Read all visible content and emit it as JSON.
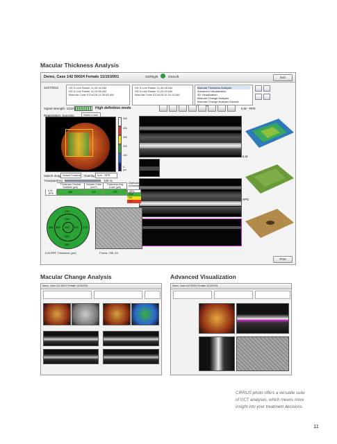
{
  "headings": {
    "macular_thickness": "Macular Thickness Analysis",
    "macular_change": "Macular Change Analysis",
    "advanced_visualization": "Advanced Visualization"
  },
  "main_window": {
    "title": "Demo, Case 142   50024   Female   11/15/2001",
    "eye_od": "OD/Right",
    "eye_os": "OS/Left",
    "exit_label": "Exit",
    "print_label": "Print",
    "exam_date": "10/27/2012",
    "scans_left": [
      "HD 5 Line Raster  11:35:42 AM",
      "HD 5 Line Raster  11:25:50 AM",
      "Macular Cube 512x128  11:30:45 AM"
    ],
    "scans_right": [
      "HD 5 Line Raster  11:36:28 AM",
      "HD 5 Line Raster  11:28:20 AM",
      "Macular Cube 512x128  11:31:15 AM"
    ],
    "analysis_items": [
      "Macular Thickness Analysis",
      "Advanced Visualization",
      "3D Visualization",
      "Macular Change Analysis",
      "Macular Change Analysis   Manual Selection"
    ],
    "signal_strength_label": "Signal strength: 10/10",
    "hd_mode_label": "High definition mode",
    "registration_label": "Registration: Success",
    "registration_value": "Switch Lists",
    "ilm_rpe": "ILM - RPE",
    "ilm": "ILM",
    "rpe": "RPE",
    "scale_values": [
      "500",
      "400",
      "300",
      "200",
      "100",
      "0 µm"
    ],
    "overlay_label": "Overlay",
    "overlay_value": "ILM - RPE",
    "switch_image_label": "Switch Image",
    "switch_image_value": "Select Fundus",
    "transparency_label": "Transparency",
    "transparency_value": "100 %",
    "table_headers": [
      "Thickness Central Subfield (µm)",
      "Volume Cube (mm³)",
      "Thickness Avg Cube (µm)"
    ],
    "table_row_label": "ILM - RPE",
    "table_row_values": [
      "262",
      "9.9",
      "275"
    ],
    "distribution_label": "Distribution of Normals",
    "distribution_values": [
      "99%",
      "95%",
      "5%",
      "1%"
    ],
    "etdrs_values": [
      "262",
      "318",
      "325",
      "320",
      "306",
      "270",
      "277",
      "290",
      "280"
    ],
    "etdrs_caption": "ILM-RPE Thickness (µm)",
    "fovea_caption": "Fovea: 256, 63"
  },
  "small_left": {
    "title": "Demo, Case 142   50024   Female   11/15/2001"
  },
  "small_right": {
    "title": "Demo, Case 142   50024   Female   11/15/2001"
  },
  "caption": "CIRRUS photo offers a versatile suite of OCT analyses, which means more insight into your treatment decisions.",
  "page_number": "11",
  "colors": {
    "thickness_normal": "#3caf3c",
    "dist_99": "#ffffff",
    "dist_95": "#3caf3c",
    "dist_5": "#f2dd1a",
    "dist_1": "#e23a2a"
  }
}
